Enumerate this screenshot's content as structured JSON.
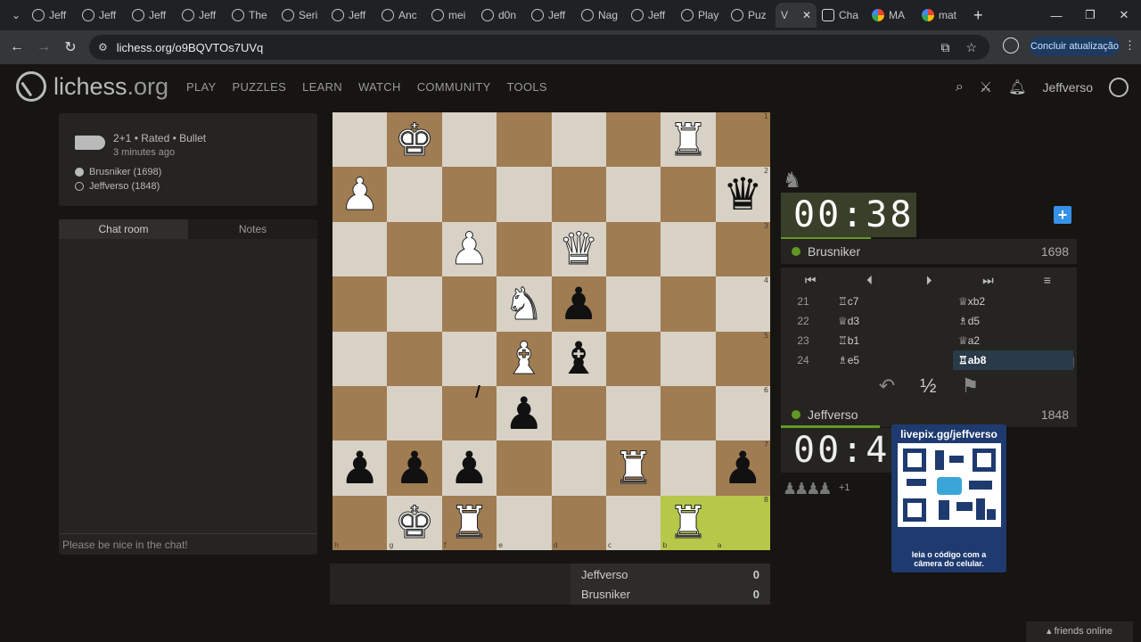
{
  "browser": {
    "tabs": [
      "Jeff",
      "Jeff",
      "Jeff",
      "Jeff",
      "The",
      "Seri",
      "Jeff",
      "Anc",
      "mei",
      "d0n",
      "Jeff",
      "Nag",
      "Jeff",
      "Play",
      "Puz"
    ],
    "active_tab": "V",
    "extra_tabs": [
      "Cha",
      "MA",
      "mat"
    ],
    "url": "lichess.org/o9BQVTOs7UVq",
    "update_button": "Concluir atualização"
  },
  "site": {
    "logo_main": "lichess",
    "logo_suffix": ".org",
    "nav": [
      "PLAY",
      "PUZZLES",
      "LEARN",
      "WATCH",
      "COMMUNITY",
      "TOOLS"
    ],
    "username": "Jeffverso"
  },
  "game_info": {
    "title": "2+1 • Rated • Bullet",
    "time_ago": "3 minutes ago",
    "player_white": "Brusniker (1698)",
    "player_black": "Jeffverso (1848)"
  },
  "chat": {
    "tab_chat": "Chat room",
    "tab_notes": "Notes",
    "placeholder": "Please be nice in the chat!"
  },
  "board": {
    "highlight_color": "#b6c84a",
    "rows": [
      [
        "",
        "wK",
        "",
        "",
        "",
        "",
        "wR",
        ""
      ],
      [
        "wP",
        "",
        "",
        "",
        "",
        "",
        "",
        "bQ"
      ],
      [
        "",
        "",
        "wP",
        "",
        "wQ",
        "",
        "",
        ""
      ],
      [
        "",
        "",
        "",
        "wN",
        "bP",
        "",
        "",
        ""
      ],
      [
        "",
        "",
        "",
        "wB",
        "bB",
        "",
        "",
        ""
      ],
      [
        "",
        "",
        "",
        "bP",
        "",
        "",
        "",
        ""
      ],
      [
        "bP",
        "bP",
        "bP",
        "",
        "",
        "wR",
        "",
        "bP"
      ],
      [
        "",
        "wK",
        "wR",
        "",
        "",
        "",
        "wR",
        ""
      ]
    ],
    "ranks": [
      "1",
      "2",
      "3",
      "4",
      "5",
      "6",
      "7",
      "8"
    ],
    "files": [
      "h",
      "g",
      "f",
      "e",
      "d",
      "c",
      "b",
      "a"
    ]
  },
  "score": {
    "p1_name": "Jeffverso",
    "p1_score": "0",
    "p2_name": "Brusniker",
    "p2_score": "0"
  },
  "clocks": {
    "top_time": "00:38",
    "bottom_time": "00:42"
  },
  "players": {
    "top_name": "Brusniker",
    "top_rating": "1698",
    "bottom_name": "Jeffverso",
    "bottom_rating": "1848"
  },
  "moves": [
    {
      "n": "21",
      "w": "♖c7",
      "b": "♕xb2"
    },
    {
      "n": "22",
      "w": "♕d3",
      "b": "♗d5"
    },
    {
      "n": "23",
      "w": "♖b1",
      "b": "♕a2"
    },
    {
      "n": "24",
      "w": "♗e5",
      "b": "♖ab8"
    }
  ],
  "actions": {
    "draw": "½"
  },
  "captured": {
    "pieces": "♟♟♟♟",
    "advantage": "+1"
  },
  "overlay": {
    "title": "livepix.gg/jeffverso",
    "footer_line1": "leia o código com a",
    "footer_line2": "câmera do celular."
  },
  "friends": "friends online"
}
